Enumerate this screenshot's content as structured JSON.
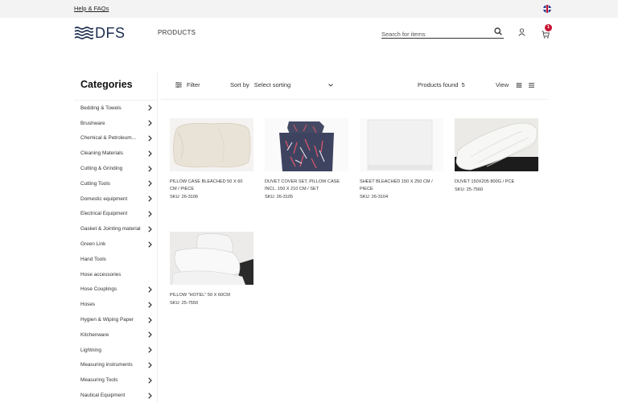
{
  "topbar": {
    "help_link": "Help & FAQs",
    "language_flag": "uk-flag-icon"
  },
  "header": {
    "logo_text": "DFS",
    "nav_products": "PRODUCTS",
    "search_placeholder": "Search for items",
    "cart_count": "1"
  },
  "sidebar": {
    "title": "Categories",
    "items": [
      {
        "label": "Bedding & Towels",
        "chevron": true
      },
      {
        "label": "Brushware",
        "chevron": true
      },
      {
        "label": "Chemical & Petroleum...",
        "chevron": true
      },
      {
        "label": "Cleaning Materials",
        "chevron": true
      },
      {
        "label": "Cutting & Grinding",
        "chevron": true
      },
      {
        "label": "Cutting Tools",
        "chevron": true
      },
      {
        "label": "Domestic equipment",
        "chevron": true
      },
      {
        "label": "Electrical Equipment",
        "chevron": true
      },
      {
        "label": "Gasket & Jointing material",
        "chevron": true
      },
      {
        "label": "Green Link",
        "chevron": true
      },
      {
        "label": "Hand Tools",
        "chevron": false
      },
      {
        "label": "Hose accessories",
        "chevron": false
      },
      {
        "label": "Hose Couplings",
        "chevron": true
      },
      {
        "label": "Hoses",
        "chevron": true
      },
      {
        "label": "Hygien & Wiping Paper",
        "chevron": true
      },
      {
        "label": "Kitchenware",
        "chevron": true
      },
      {
        "label": "Lightning",
        "chevron": true
      },
      {
        "label": "Measuring instruments",
        "chevron": true
      },
      {
        "label": "Measuring Tools",
        "chevron": true
      },
      {
        "label": "Nautical Equipment",
        "chevron": true
      }
    ]
  },
  "toolbar": {
    "filter_label": "Filter",
    "sort_label": "Sort by",
    "sort_value": "Select sorting",
    "found_label": "Products found",
    "found_count": "5",
    "view_label": "View"
  },
  "products": [
    {
      "name": "PILLOW CASE BLEACHED 50 X 60 CM / PIECE",
      "sku": "SKU: 26-3106",
      "image": "pillow-case"
    },
    {
      "name": "DUVET COVER SET, PILLOW CASE INCL. 150 X 210 CM / SET",
      "sku": "SKU: 26-3105",
      "image": "duvet-cover-set"
    },
    {
      "name": "SHEET BLEACHED 150 X 250 CM / PIECE",
      "sku": "SKU: 26-3104",
      "image": "sheet"
    },
    {
      "name": "DUVET 150X205 800G / PCE",
      "sku": "SKU: 25-7560",
      "image": "duvet"
    },
    {
      "name": "PILLOW \"HOTEL\" 50 X 60CM",
      "sku": "SKU: 25-7550",
      "image": "pillow-hotel"
    }
  ]
}
